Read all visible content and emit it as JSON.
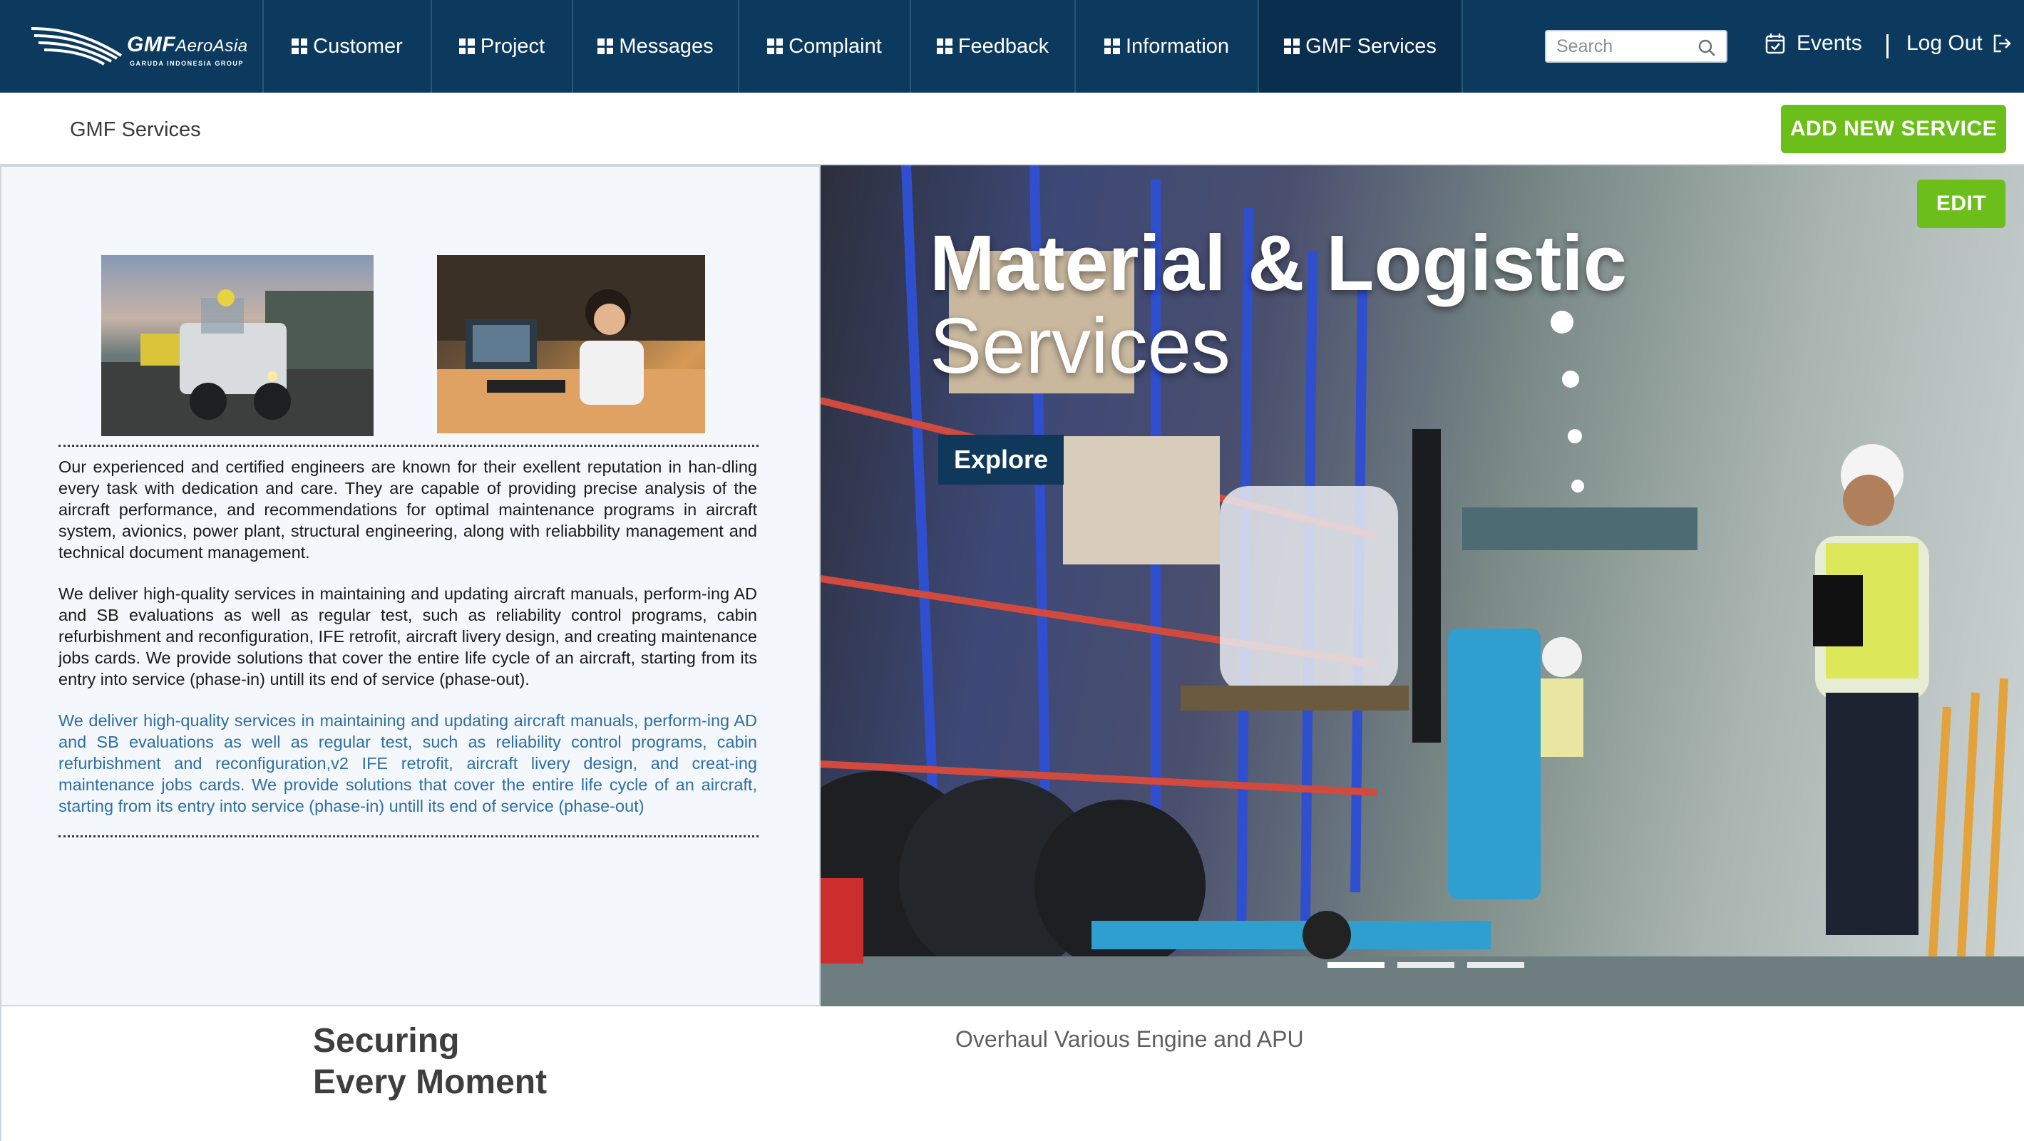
{
  "nav": {
    "logo_brand": "GMF",
    "logo_brand_suffix": "AeroAsia",
    "logo_sub": "GARUDA INDONESIA GROUP",
    "items": [
      {
        "label": "Customer"
      },
      {
        "label": "Project"
      },
      {
        "label": "Messages"
      },
      {
        "label": "Complaint"
      },
      {
        "label": "Feedback"
      },
      {
        "label": "Information"
      },
      {
        "label": "GMF Services",
        "active": true
      }
    ],
    "search_placeholder": "Search",
    "events_label": "Events",
    "logout_label": "Log Out"
  },
  "subheader": {
    "title": "GMF Services",
    "add_button": "ADD NEW SERVICE"
  },
  "left": {
    "paragraphs": [
      "Our experienced and certified engineers are known for their exellent reputation in han-dling every task with dedication and care. They are capable of providing precise analysis of the aircraft performance, and recommendations for optimal maintenance programs in aircraft system, avionics, power plant, structural engineering, along with reliabbility management and technical document management.",
      "We deliver high-quality services in maintaining and updating aircraft manuals, perform-ing AD and SB evaluations as well as regular test, such as reliability control programs, cabin refurbishment and reconfiguration, IFE retrofit, aircraft livery design, and creating maintenance jobs cards. We provide solutions that cover the entire life cycle of an aircraft, starting from its entry into service (phase-in) untill its end of service (phase-out).",
      "We deliver high-quality services in maintaining and updating aircraft manuals, perform-ing AD and SB evaluations as well as regular test, such as reliability control programs, cabin refurbishment and reconfiguration,v2 IFE retrofit, aircraft livery design, and creat-ing maintenance jobs cards. We provide solutions that cover the entire life cycle of an aircraft, starting from its entry into service (phase-in) untill its end of service (phase-out)"
    ]
  },
  "hero": {
    "title_line1": "Material & Logistic",
    "title_line2": "Services",
    "explore_label": "Explore",
    "edit_label": "EDIT",
    "slides_total": 3,
    "slide_active": 1
  },
  "bottom": {
    "tagline_line1": "Securing",
    "tagline_line2": "Every Moment",
    "service_item": "Overhaul Various Engine and APU"
  },
  "colors": {
    "nav_bg": "#0c3a5e",
    "accent_green": "#6cbf1a",
    "link_blue": "#2d6fa3",
    "panel_bg": "#f4f7fc"
  },
  "icons": {
    "logo": "gmf-swoosh-icon",
    "nav": "grid-icon",
    "search": "search-icon",
    "events": "calendar-icon",
    "logout": "logout-icon"
  }
}
